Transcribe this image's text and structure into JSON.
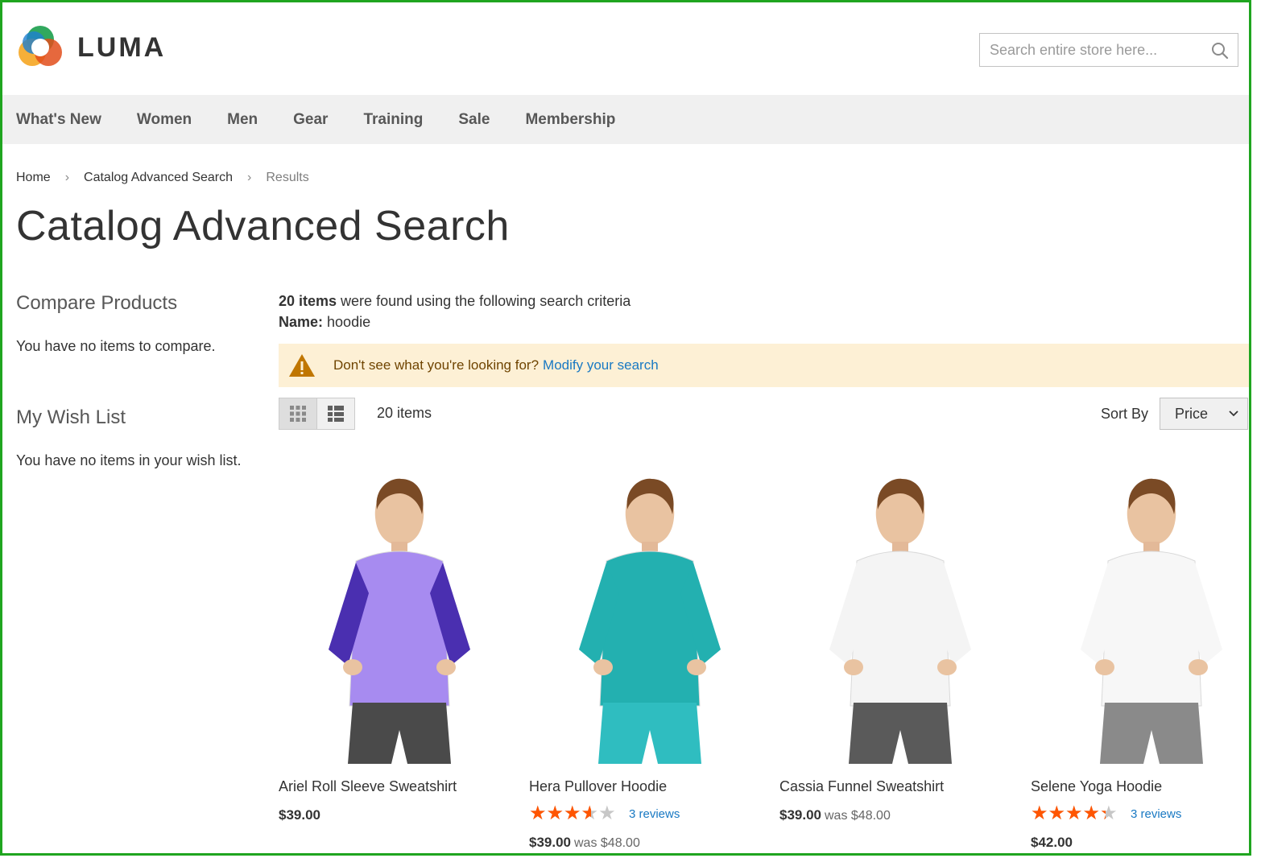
{
  "header": {
    "brand": "LUMA",
    "search_placeholder": "Search entire store here..."
  },
  "nav": {
    "items": [
      "What's New",
      "Women",
      "Men",
      "Gear",
      "Training",
      "Sale",
      "Membership"
    ]
  },
  "breadcrumb": {
    "items": [
      "Home",
      "Catalog Advanced Search",
      "Results"
    ],
    "separator": "›"
  },
  "page": {
    "title": "Catalog Advanced Search"
  },
  "sidebar": {
    "compare_title": "Compare Products",
    "compare_empty": "You have no items to compare.",
    "wishlist_title": "My Wish List",
    "wishlist_empty": "You have no items in your wish list."
  },
  "results": {
    "count_bold": "20 items",
    "count_rest": " were found using the following search criteria",
    "criteria_label": "Name:",
    "criteria_value": " hoodie",
    "notice_text": "Don't see what you're looking for?",
    "notice_link": "Modify your search"
  },
  "toolbar": {
    "amount": "20 items",
    "sort_label": "Sort By",
    "sort_value": "Price"
  },
  "colors": {
    "accent_link": "#1979c3",
    "star": "#ff5501",
    "notice_bg": "#fdf0d5",
    "nav_bg": "#f0f0f0"
  },
  "products": [
    {
      "name": "Ariel Roll Sleeve Sweatshirt",
      "price": "$39.00",
      "was": "",
      "rating": 0,
      "reviews": "",
      "shirt": "#a78bf0",
      "sleeve": "#4a2fb0",
      "bottom": "#4a4a4a"
    },
    {
      "name": "Hera Pullover Hoodie",
      "price": "$39.00",
      "was": "was $48.00",
      "rating": 0.66,
      "reviews": "3 reviews",
      "shirt": "#23b0b0",
      "sleeve": "#23b0b0",
      "bottom": "#2fbdc0"
    },
    {
      "name": "Cassia Funnel Sweatshirt",
      "price": "$39.00",
      "was": "was $48.00",
      "rating": 0,
      "reviews": "",
      "shirt": "#f4f4f4",
      "sleeve": "#f4f4f4",
      "bottom": "#5a5a5a"
    },
    {
      "name": "Selene Yoga Hoodie",
      "price": "$42.00",
      "was": "",
      "rating": 0.8,
      "reviews": "3 reviews",
      "shirt": "#f7f7f7",
      "sleeve": "#f7f7f7",
      "bottom": "#8a8a8a"
    }
  ]
}
